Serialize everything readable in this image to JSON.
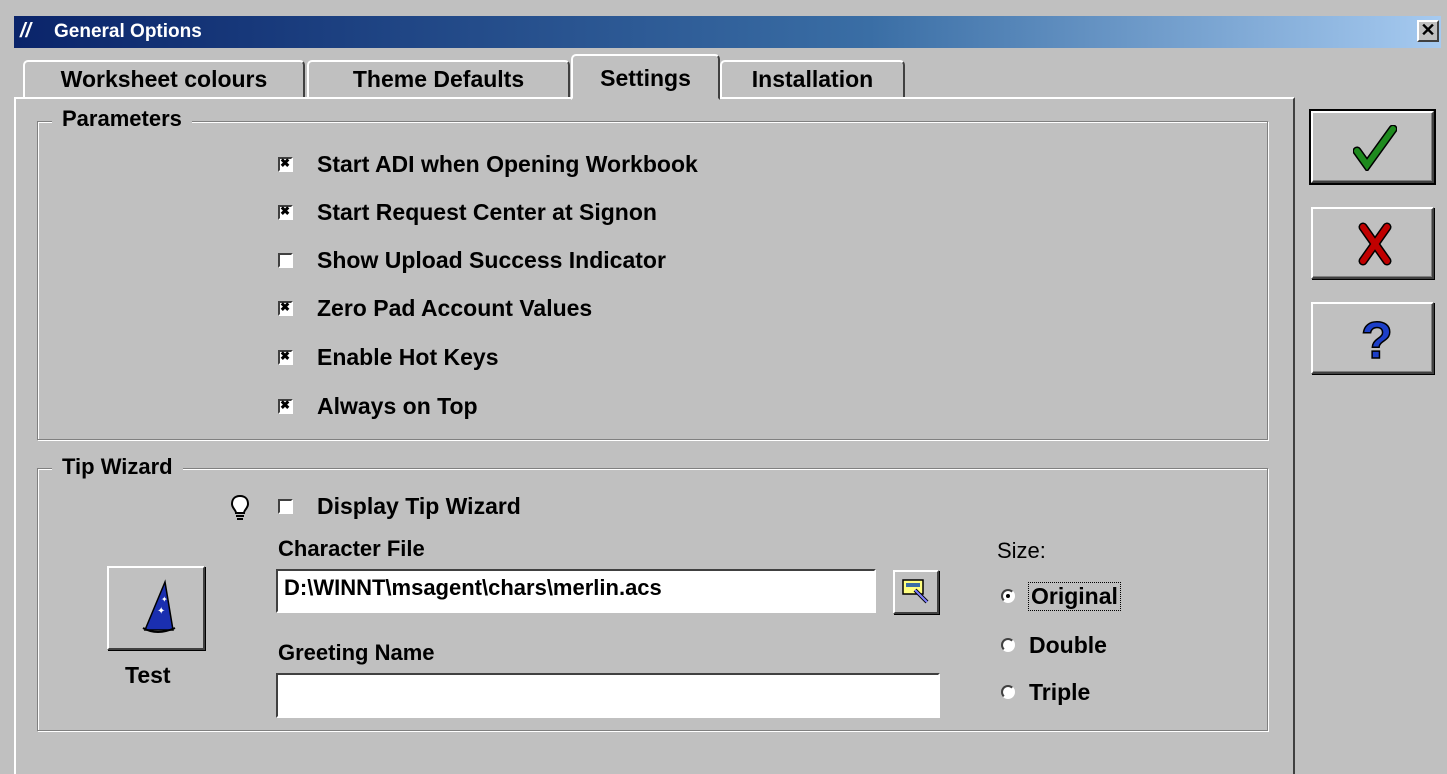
{
  "window": {
    "title": "General Options",
    "close_label": "✕"
  },
  "tabs": [
    {
      "label": "Worksheet colours",
      "active": false
    },
    {
      "label": "Theme Defaults",
      "active": false
    },
    {
      "label": "Settings",
      "active": true
    },
    {
      "label": "Installation",
      "active": false
    }
  ],
  "parameters": {
    "heading": "Parameters",
    "options": [
      {
        "label": "Start ADI when Opening Workbook",
        "checked": true
      },
      {
        "label": "Start Request Center at Signon",
        "checked": true
      },
      {
        "label": "Show Upload Success Indicator",
        "checked": false
      },
      {
        "label": "Zero Pad Account Values",
        "checked": true
      },
      {
        "label": "Enable Hot Keys",
        "checked": true
      },
      {
        "label": "Always on Top",
        "checked": true
      }
    ]
  },
  "tip_wizard": {
    "heading": "Tip Wizard",
    "display_label": "Display Tip Wizard",
    "display_checked": false,
    "character_file_label": "Character File",
    "character_file_value": "D:\\WINNT\\msagent\\chars\\merlin.acs",
    "greeting_name_label": "Greeting Name",
    "greeting_name_value": "",
    "test_label": "Test",
    "size_label": "Size:",
    "size_options": [
      {
        "label": "Original",
        "selected": true
      },
      {
        "label": "Double",
        "selected": false
      },
      {
        "label": "Triple",
        "selected": false
      }
    ]
  },
  "side_buttons": [
    {
      "icon": "check-icon",
      "color": "#1e8a1e"
    },
    {
      "icon": "cross-icon",
      "color": "#c00000"
    },
    {
      "icon": "help-icon",
      "color": "#1c3fc8"
    }
  ]
}
